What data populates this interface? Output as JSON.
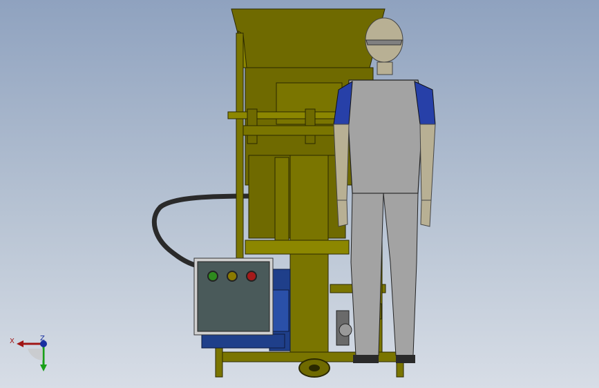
{
  "viewport": {
    "background_top": "#8fa2bf",
    "background_bottom": "#d7dde6"
  },
  "machine": {
    "body_color": "#6f6a00",
    "body_highlight": "#8c8700",
    "outline_color": "#2a2800",
    "motor_color": "#1f3f8a",
    "hose_color": "#2a2a2a"
  },
  "control_box": {
    "panel_color": "#4a5a5a",
    "frame_color": "#d0d0d0",
    "indicator_lights": [
      {
        "name": "green-indicator-light",
        "color": "#2e8a1e"
      },
      {
        "name": "yellow-indicator-light",
        "color": "#8a7a00"
      },
      {
        "name": "red-indicator-light",
        "color": "#a51a1a"
      }
    ]
  },
  "mannequin": {
    "skin_color": "#b8b094",
    "suit_color": "#a3a3a3",
    "sleeve_color": "#2740a8",
    "shoe_color": "#2a2a2a"
  },
  "triad": {
    "x_label": "X",
    "z_label": "Z",
    "x_color": "#a01515",
    "y_color": "#18a018",
    "z_color": "#1830a0"
  }
}
